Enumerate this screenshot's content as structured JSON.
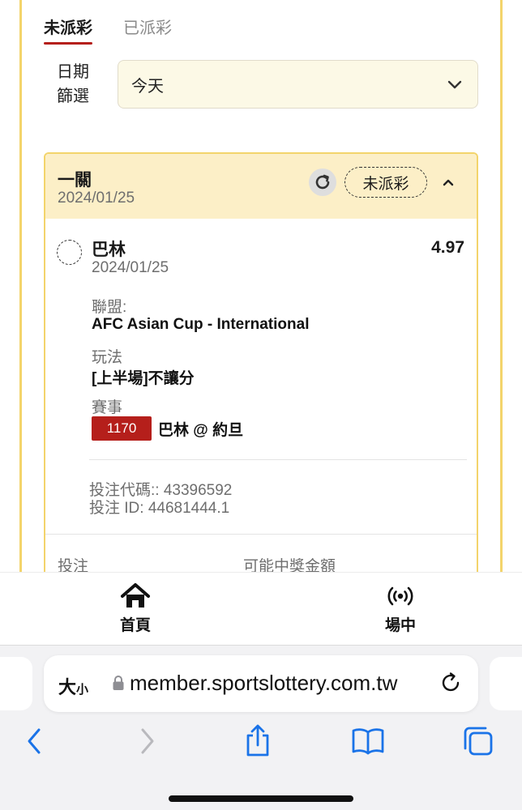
{
  "tabs": [
    {
      "label": "未派彩"
    },
    {
      "label": "已派彩"
    }
  ],
  "date_filter": {
    "label": "日期篩選",
    "value": "今天"
  },
  "bet_card": {
    "title": "一關",
    "date": "2024/01/25",
    "status": "未派彩",
    "selection": {
      "team": "巴林",
      "odds": "4.97",
      "date": "2024/01/25",
      "league_label": "聯盟:",
      "league_value": "AFC Asian Cup - International",
      "play_label": "玩法",
      "play_value": "[上半場]不讓分",
      "event_label": "賽事",
      "match_code": "1170",
      "match_name": "巴林 @ 約旦"
    },
    "bet_code": "投注代碼:: 43396592",
    "bet_id": "投注 ID: 44681444.1",
    "footer": {
      "stake_label": "投注",
      "payout_label": "可能中獎金額"
    }
  },
  "bottom_nav": [
    {
      "label": "首頁",
      "icon": "home-icon"
    },
    {
      "label": "場中",
      "icon": "live-broadcast-icon"
    }
  ],
  "browser": {
    "text_size_label": "大",
    "text_size_small": "小",
    "url": "member.sportslottery.com.tw"
  }
}
